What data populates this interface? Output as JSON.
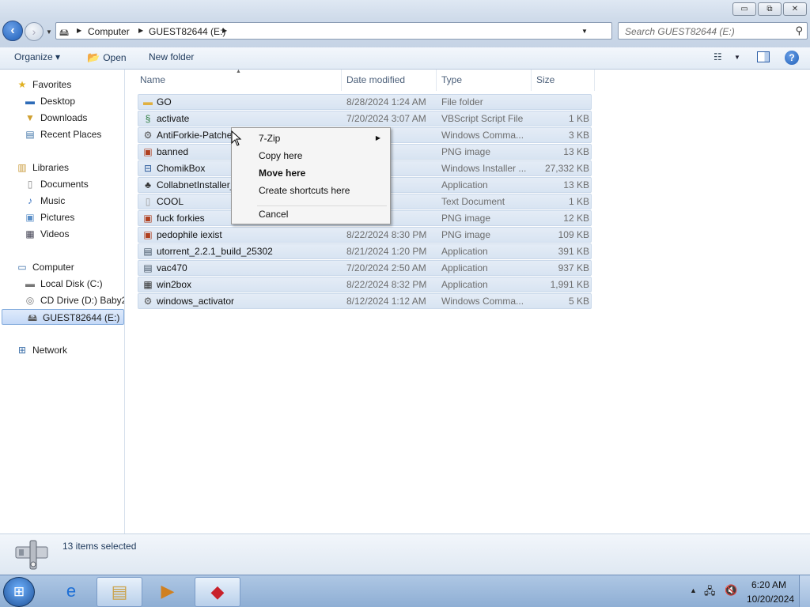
{
  "window": {
    "minimize_glyph": "▭",
    "maximize_glyph": "⧉",
    "close_glyph": "✕"
  },
  "address": {
    "crumbs": [
      "Computer",
      "GUEST82644 (E:)"
    ],
    "search_placeholder": "Search GUEST82644 (E:)"
  },
  "toolbar": {
    "organize": "Organize ▾",
    "open": "Open",
    "new_folder": "New folder"
  },
  "nav": {
    "favorites": "Favorites",
    "desktop": "Desktop",
    "downloads": "Downloads",
    "recent_places": "Recent Places",
    "libraries": "Libraries",
    "documents": "Documents",
    "music": "Music",
    "pictures": "Pictures",
    "videos": "Videos",
    "computer": "Computer",
    "local_disk": "Local Disk (C:)",
    "cd_drive": "CD Drive (D:) Baby2",
    "guest_drive": "GUEST82644 (E:)",
    "network": "Network"
  },
  "columns": {
    "name": "Name",
    "date": "Date modified",
    "type": "Type",
    "size": "Size"
  },
  "files": [
    {
      "name": "GO",
      "date": "8/28/2024 1:24 AM",
      "type": "File folder",
      "size": "",
      "icon": "folder-icon"
    },
    {
      "name": "activate",
      "date": "7/20/2024 3:07 AM",
      "type": "VBScript Script File",
      "size": "1 KB",
      "icon": "script-icon"
    },
    {
      "name": "AntiForkie-Patche",
      "date": "9:20 PM",
      "type": "Windows Comma...",
      "size": "3 KB",
      "icon": "command-icon"
    },
    {
      "name": "banned",
      "date": "3:59 AM",
      "type": "PNG image",
      "size": "13 KB",
      "icon": "image-icon"
    },
    {
      "name": "ChomikBox",
      "date": "1:20 PM",
      "type": "Windows Installer ...",
      "size": "27,332 KB",
      "icon": "installer-icon"
    },
    {
      "name": "CollabnetInstaller_",
      "date": "3:28 PM",
      "type": "Application",
      "size": "13 KB",
      "icon": "app-icon"
    },
    {
      "name": "COOL",
      "date": "3:51 AM",
      "type": "Text Document",
      "size": "1 KB",
      "icon": "text-icon"
    },
    {
      "name": "fuck forkies",
      "date": "3:35 PM",
      "type": "PNG image",
      "size": "12 KB",
      "icon": "image-icon"
    },
    {
      "name": "pedophile iexist",
      "date": "8/22/2024 8:30 PM",
      "type": "PNG image",
      "size": "109 KB",
      "icon": "image-icon"
    },
    {
      "name": "utorrent_2.2.1_build_25302",
      "date": "8/21/2024 1:20 PM",
      "type": "Application",
      "size": "391 KB",
      "icon": "app-icon"
    },
    {
      "name": "vac470",
      "date": "7/20/2024 2:50 AM",
      "type": "Application",
      "size": "937 KB",
      "icon": "app-icon"
    },
    {
      "name": "win2box",
      "date": "8/22/2024 8:32 PM",
      "type": "Application",
      "size": "1,991 KB",
      "icon": "app-icon"
    },
    {
      "name": "windows_activator",
      "date": "8/12/2024 1:12 AM",
      "type": "Windows Comma...",
      "size": "5 KB",
      "icon": "command-icon"
    }
  ],
  "context_menu": {
    "zip": "7-Zip",
    "copy": "Copy here",
    "move": "Move here",
    "shortcuts": "Create shortcuts here",
    "cancel": "Cancel"
  },
  "status": {
    "selected": "13 items selected"
  },
  "clock": {
    "time": "6:20 AM",
    "date": "10/20/2024"
  },
  "colors": {
    "selection": "#d8e4f2",
    "accent": "#1e395b",
    "taskbar": "#9fbbdd"
  }
}
